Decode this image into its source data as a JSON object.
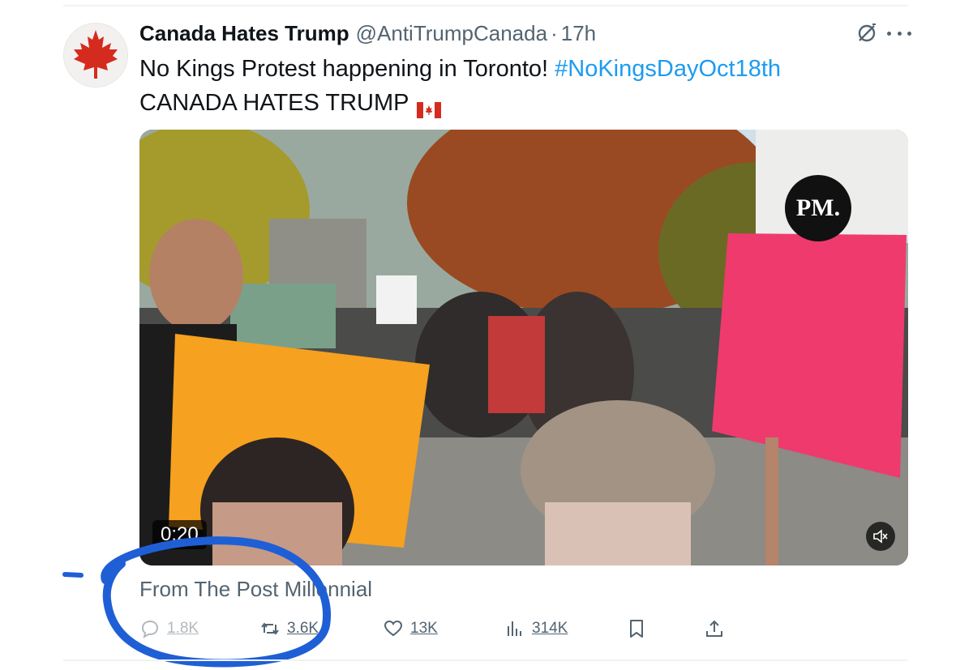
{
  "tweet": {
    "author_name": "Canada Hates Trump",
    "handle": "@AntiTrumpCanada",
    "separator": "·",
    "time": "17h",
    "text_line1": "No Kings Protest happening in Toronto!",
    "hashtag": "#NoKingsDayOct18th",
    "text_line2": "CANADA HATES TRUMP",
    "media": {
      "duration": "0:20",
      "watermark": "PM.",
      "muted": true
    },
    "source": "From The Post Millennial"
  },
  "actions": {
    "replies": "1.8K",
    "reposts": "3.6K",
    "likes": "13K",
    "views": "314K"
  },
  "icons": {
    "reply": "speech-bubble-icon",
    "repost": "repost-arrows-icon",
    "like": "heart-icon",
    "views": "bar-chart-icon",
    "bookmark": "bookmark-icon",
    "share": "share-upload-icon",
    "grok": "grok-icon",
    "more": "more-dots-icon",
    "mute": "muted-speaker-icon"
  },
  "colors": {
    "hashtag": "#1d9bf0",
    "secondary_text": "#536471",
    "annotation_circle": "#1f5fd6"
  }
}
